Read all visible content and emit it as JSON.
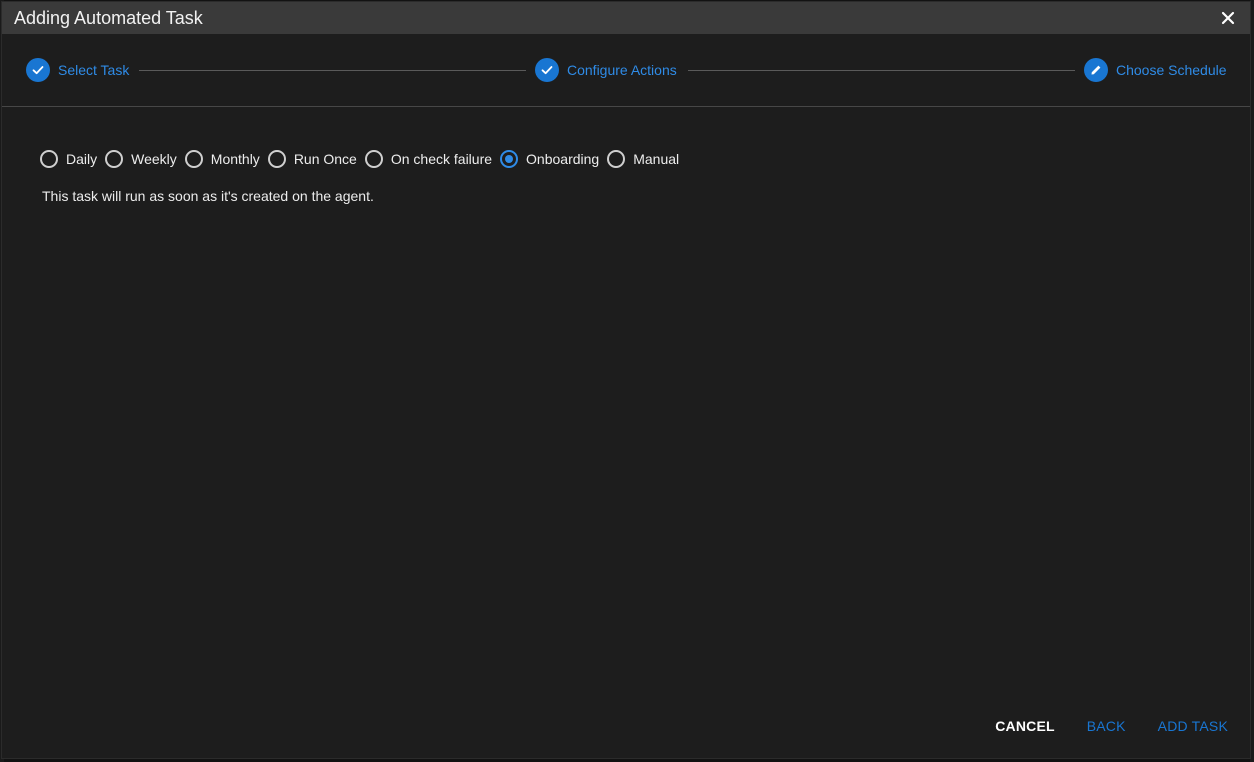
{
  "dialog": {
    "title": "Adding Automated Task"
  },
  "stepper": {
    "steps": [
      {
        "label": "Select Task",
        "state": "completed",
        "icon": "check-icon"
      },
      {
        "label": "Configure Actions",
        "state": "completed",
        "icon": "check-icon"
      },
      {
        "label": "Choose Schedule",
        "state": "active",
        "icon": "pencil-icon"
      }
    ]
  },
  "schedule": {
    "options": [
      {
        "label": "Daily",
        "selected": false
      },
      {
        "label": "Weekly",
        "selected": false
      },
      {
        "label": "Monthly",
        "selected": false
      },
      {
        "label": "Run Once",
        "selected": false
      },
      {
        "label": "On check failure",
        "selected": false
      },
      {
        "label": "Onboarding",
        "selected": true
      },
      {
        "label": "Manual",
        "selected": false
      }
    ],
    "description": "This task will run as soon as it's created on the agent."
  },
  "actions": {
    "cancel_label": "CANCEL",
    "back_label": "BACK",
    "add_label": "ADD TASK"
  },
  "colors": {
    "accent": "#1976d2",
    "accent_text": "#2f8be6",
    "background": "#1d1d1d",
    "titlebar": "#3a3a3a"
  }
}
